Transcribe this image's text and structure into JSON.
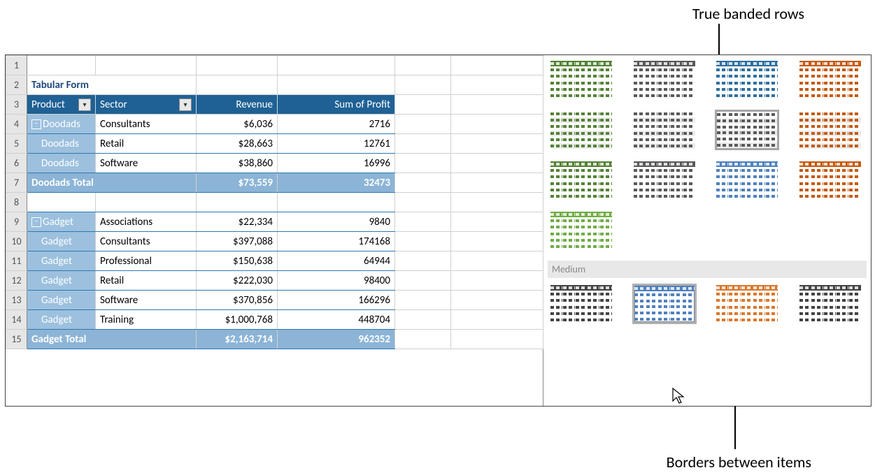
{
  "callouts": {
    "top": "True banded rows",
    "bottom": "Borders between items"
  },
  "sheet": {
    "title": "Tabular Form",
    "row_numbers": [
      "1",
      "2",
      "3",
      "4",
      "5",
      "6",
      "7",
      "8",
      "9",
      "10",
      "11",
      "12",
      "13",
      "14",
      "15"
    ],
    "headers": {
      "product": "Product",
      "sector": "Sector",
      "revenue": "Revenue",
      "profit": "Sum of Profit"
    },
    "groups": [
      {
        "name": "Doodads",
        "rows": [
          {
            "product": "Doodads",
            "sector": "Consultants",
            "revenue": "$6,036",
            "profit": "2716"
          },
          {
            "product": "Doodads",
            "sector": "Retail",
            "revenue": "$28,663",
            "profit": "12761"
          },
          {
            "product": "Doodads",
            "sector": "Software",
            "revenue": "$38,860",
            "profit": "16996"
          }
        ],
        "total_label": "Doodads Total",
        "total_revenue": "$73,559",
        "total_profit": "32473"
      },
      {
        "name": "Gadget",
        "rows": [
          {
            "product": "Gadget",
            "sector": "Associations",
            "revenue": "$22,334",
            "profit": "9840"
          },
          {
            "product": "Gadget",
            "sector": "Consultants",
            "revenue": "$397,088",
            "profit": "174168"
          },
          {
            "product": "Gadget",
            "sector": "Professional",
            "revenue": "$150,638",
            "profit": "64944"
          },
          {
            "product": "Gadget",
            "sector": "Retail",
            "revenue": "$222,030",
            "profit": "98400"
          },
          {
            "product": "Gadget",
            "sector": "Software",
            "revenue": "$370,856",
            "profit": "166296"
          },
          {
            "product": "Gadget",
            "sector": "Training",
            "revenue": "$1,000,768",
            "profit": "448704"
          }
        ],
        "total_label": "Gadget Total",
        "total_revenue": "$2,163,714",
        "total_profit": "962352"
      }
    ]
  },
  "gallery": {
    "medium_label": "Medium",
    "row1": [
      {
        "color": "c-green"
      },
      {
        "color": "c-grey"
      },
      {
        "color": "c-blue",
        "highlight": true
      },
      {
        "color": "c-orange"
      }
    ],
    "row2": [
      {
        "color": "c-green"
      },
      {
        "color": "c-grey"
      },
      {
        "color": "c-grey",
        "selected": true
      },
      {
        "color": "c-orange"
      }
    ],
    "row3": [
      {
        "color": "c-green"
      },
      {
        "color": "c-grey"
      },
      {
        "color": "c-ltblue"
      },
      {
        "color": "c-orange"
      }
    ],
    "row4": [
      {
        "color": "c-ltgreen"
      }
    ],
    "medium_row": [
      {
        "color": "c-dkgrey"
      },
      {
        "color": "c-ltblue",
        "hovered": true
      },
      {
        "color": "c-ltorange"
      },
      {
        "color": "c-dkgrey"
      }
    ]
  }
}
